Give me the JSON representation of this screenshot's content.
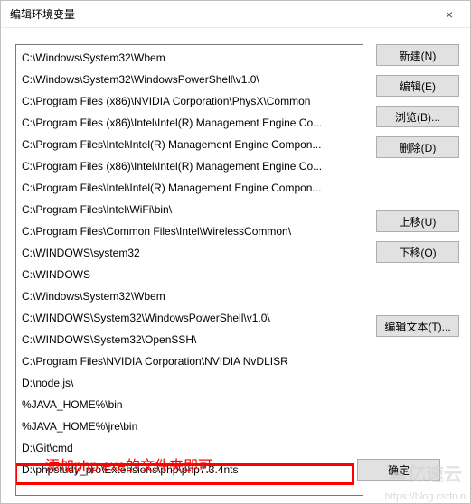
{
  "window": {
    "title": "编辑环境变量",
    "close_glyph": "×"
  },
  "list": {
    "items": [
      "C:\\Windows\\System32\\Wbem",
      "C:\\Windows\\System32\\WindowsPowerShell\\v1.0\\",
      "C:\\Program Files (x86)\\NVIDIA Corporation\\PhysX\\Common",
      "C:\\Program Files (x86)\\Intel\\Intel(R) Management Engine Co...",
      "C:\\Program Files\\Intel\\Intel(R) Management Engine Compon...",
      "C:\\Program Files (x86)\\Intel\\Intel(R) Management Engine Co...",
      "C:\\Program Files\\Intel\\Intel(R) Management Engine Compon...",
      "C:\\Program Files\\Intel\\WiFi\\bin\\",
      "C:\\Program Files\\Common Files\\Intel\\WirelessCommon\\",
      "C:\\WINDOWS\\system32",
      "C:\\WINDOWS",
      "C:\\Windows\\System32\\Wbem",
      "C:\\WINDOWS\\System32\\WindowsPowerShell\\v1.0\\",
      "C:\\WINDOWS\\System32\\OpenSSH\\",
      "C:\\Program Files\\NVIDIA Corporation\\NVIDIA NvDLISR",
      "D:\\node.js\\",
      "%JAVA_HOME%\\bin",
      "%JAVA_HOME%\\jre\\bin",
      "D:\\Git\\cmd",
      "D:\\phpstudy_pro\\Extensions\\php\\php7.3.4nts"
    ]
  },
  "buttons": {
    "new": "新建(N)",
    "edit": "编辑(E)",
    "browse": "浏览(B)...",
    "delete": "删除(D)",
    "moveup": "上移(U)",
    "movedown": "下移(O)",
    "edittext": "编辑文本(T)...",
    "ok": "确定"
  },
  "annotation": "添加php.exe的文件夹即可",
  "watermark": "https://blog.csdn.n",
  "logo": "亿速云",
  "colors": {
    "highlight": "#ff0000"
  }
}
